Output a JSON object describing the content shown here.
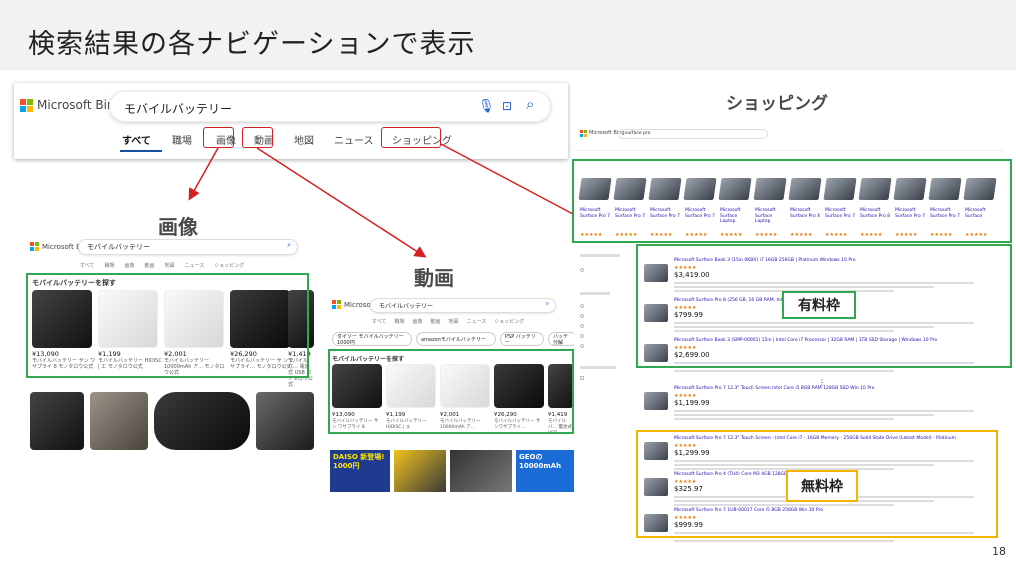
{
  "slide": {
    "title": "検索結果の各ナビゲーションで表示",
    "page_number": "18"
  },
  "bing_main": {
    "logo_text": "Microsoft Bing",
    "query": "モバイルバッテリー",
    "tabs": [
      "すべて",
      "職場",
      "画像",
      "動画",
      "地図",
      "ニュース",
      "ショッピング"
    ],
    "active_tab": "すべて"
  },
  "labels": {
    "images": "画像",
    "videos": "動画",
    "shopping": "ショッピング",
    "paid": "有料枠",
    "free": "無料枠"
  },
  "images_panel": {
    "logo_text": "Microsoft Bing",
    "query": "モバイルバッテリー",
    "tabs": [
      "すべて",
      "職場",
      "画像",
      "動画",
      "地図",
      "ニュース",
      "ショッピング"
    ],
    "group_title": "モバイルバッテリーを探す",
    "products": [
      {
        "price": "¥13,090",
        "desc": "モバイルバッテリー サン ワサプライ 8 モノタロウ公式"
      },
      {
        "price": "¥1,199",
        "desc": "モバイルバッテリー HIDISC | エ モノタロウ公式"
      },
      {
        "price": "¥2,001",
        "desc": "モバイルバッテリー 10000mAh ア… モノタロウ公式"
      },
      {
        "price": "¥26,290",
        "desc": "モバイルバッテリー サ ンワサプライ… モノタロウ公式"
      },
      {
        "price": "¥1,419",
        "desc": "モバイルバ… 電池式 USB モノタロウ公式"
      }
    ]
  },
  "videos_panel": {
    "logo_text": "Microsoft Bing",
    "query": "モバイルバッテリー",
    "tabs": [
      "すべて",
      "職場",
      "画像",
      "動画",
      "地図",
      "ニュース",
      "ショッピング"
    ],
    "chips": [
      "ダイソー モバイルバッテリー 1000円",
      "amazonモバイルバッテリー",
      "PSP バッテリー",
      "バッテ 分解"
    ],
    "group_title": "モバイルバッテリーを探す",
    "products": [
      {
        "price": "¥13,090",
        "desc": "モバイルバッテリー サン ワサプライ 8"
      },
      {
        "price": "¥1,199",
        "desc": "モバイルバッテリー HIDISC | エ"
      },
      {
        "price": "¥2,001",
        "desc": "モバイルバッテリー 10000mAh ア…"
      },
      {
        "price": "¥26,290",
        "desc": "モバイルバッテリー サ ンワサプライ…"
      },
      {
        "price": "¥1,419",
        "desc": "モバイルバ… 電池式 USB"
      }
    ],
    "thumbs": [
      "DAISO 新登場! 1000円",
      "",
      "",
      "GEOの 10000mAh"
    ]
  },
  "shopping_panel": {
    "logo_text": "Microsoft Bing",
    "query": "surface pro",
    "carousel_items": [
      "Microsoft Surface Pro 7",
      "Microsoft Surface Pro 7",
      "Microsoft Surface Pro 7",
      "Microsoft Surface Pro 7",
      "Microsoft Surface Laptop",
      "Microsoft Surface Laptop",
      "Microsoft Surface Pro X",
      "Microsoft Surface Pro 7",
      "Microsoft Surface Pro 8",
      "Microsoft Surface Pro 7",
      "Microsoft Surface Pro 7",
      "Microsoft Surface"
    ],
    "paid_results": [
      {
        "title": "Microsoft Surface Book 3 (15in 0KBX) i7 16GB 256GB | Platinum Windows 10 Pro",
        "price": "$3,419.00"
      },
      {
        "title": "Microsoft Surface Pro 8 (256 GB, 16 GB RAM, Intel Core i5)",
        "price": "$799.99"
      },
      {
        "title": "Microsoft Surface Book 3 (SMP-00001) 15in | Intel Core i7 Processor | 32GB RAM | 1TB SSD Storage | Windows 10 Pro",
        "price": "$2,699.00"
      }
    ],
    "mid_result": {
      "title": "Microsoft Surface Pro 7 12.3\" Touch Screen Intel Core i5 8GB RAM 128GB SSD Win 10 Pro",
      "price": "$1,199.99"
    },
    "free_results": [
      {
        "title": "Microsoft Surface Pro 7 12.3\" Touch Screen - Intel Core i7 - 16GB Memory - 256GB Solid State Drive (Latest Model) - Platinum",
        "price": "$1,299.99"
      },
      {
        "title": "Microsoft Surface Pro 4 (TU4) Core M3 4GB 128GB Windows 10 Pro",
        "price": "$325.97"
      },
      {
        "title": "Microsoft Surface Pro 7 1UB-00017 Core i5 8GB 256GB Win 10 Pro",
        "price": "$999.99"
      }
    ]
  },
  "colors": {
    "red": "#d32020",
    "green": "#2fa84f",
    "yellow": "#f2b600",
    "bing_blue": "#1a5fd0"
  }
}
